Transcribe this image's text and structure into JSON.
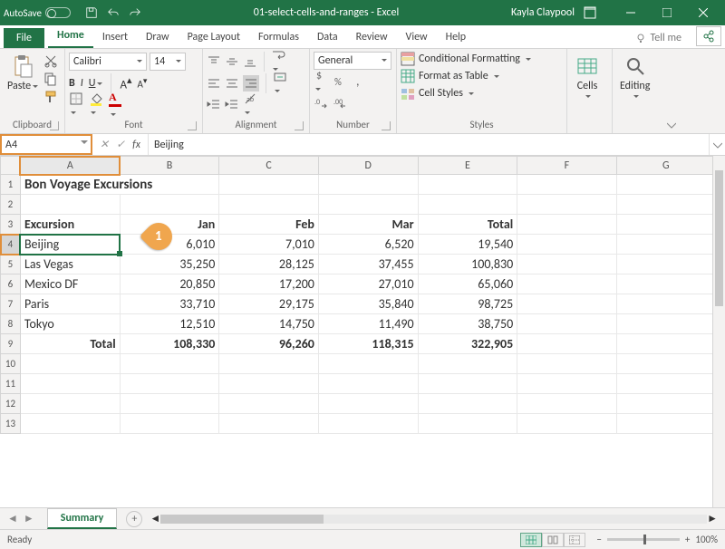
{
  "title": {
    "autosave": "AutoSave",
    "doc": "01-select-cells-and-ranges  -  Excel",
    "user": "Kayla Claypool"
  },
  "tabs": {
    "file": "File",
    "home": "Home",
    "insert": "Insert",
    "draw": "Draw",
    "pagelayout": "Page Layout",
    "formulas": "Formulas",
    "data": "Data",
    "review": "Review",
    "view": "View",
    "help": "Help",
    "tellme": "Tell me"
  },
  "ribbon": {
    "clipboard": {
      "label": "Clipboard",
      "paste": "Paste"
    },
    "font": {
      "label": "Font",
      "name": "Calibri",
      "size": "14"
    },
    "alignment": {
      "label": "Alignment"
    },
    "number": {
      "label": "Number",
      "format": "General"
    },
    "styles": {
      "label": "Styles",
      "cond": "Conditional Formatting",
      "table": "Format as Table",
      "cell": "Cell Styles"
    },
    "cells": {
      "label": "Cells",
      "btn": "Cells"
    },
    "editing": {
      "label": "Editing",
      "btn": "Editing"
    }
  },
  "namebox": "A4",
  "formula": "Beijing",
  "cols": [
    "A",
    "B",
    "C",
    "D",
    "E",
    "F",
    "G"
  ],
  "rows": {
    "1": {
      "A": "Bon Voyage Excursions"
    },
    "3": {
      "A": "Excursion",
      "B": "Jan",
      "C": "Feb",
      "D": "Mar",
      "E": "Total"
    },
    "4": {
      "A": "Beijing",
      "B": "6,010",
      "C": "7,010",
      "D": "6,520",
      "E": "19,540"
    },
    "5": {
      "A": "Las Vegas",
      "B": "35,250",
      "C": "28,125",
      "D": "37,455",
      "E": "100,830"
    },
    "6": {
      "A": "Mexico DF",
      "B": "20,850",
      "C": "17,200",
      "D": "27,010",
      "E": "65,060"
    },
    "7": {
      "A": "Paris",
      "B": "33,710",
      "C": "29,175",
      "D": "35,840",
      "E": "98,725"
    },
    "8": {
      "A": "Tokyo",
      "B": "12,510",
      "C": "14,750",
      "D": "11,490",
      "E": "38,750"
    },
    "9": {
      "A": "Total",
      "B": "108,330",
      "C": "96,260",
      "D": "118,315",
      "E": "322,905"
    }
  },
  "callout": "1",
  "sheet": {
    "active": "Summary"
  },
  "status": {
    "ready": "Ready",
    "zoom": "100%"
  },
  "chart_data": {
    "type": "table",
    "title": "Bon Voyage Excursions",
    "columns": [
      "Excursion",
      "Jan",
      "Feb",
      "Mar",
      "Total"
    ],
    "rows": [
      {
        "Excursion": "Beijing",
        "Jan": 6010,
        "Feb": 7010,
        "Mar": 6520,
        "Total": 19540
      },
      {
        "Excursion": "Las Vegas",
        "Jan": 35250,
        "Feb": 28125,
        "Mar": 37455,
        "Total": 100830
      },
      {
        "Excursion": "Mexico DF",
        "Jan": 20850,
        "Feb": 17200,
        "Mar": 27010,
        "Total": 65060
      },
      {
        "Excursion": "Paris",
        "Jan": 33710,
        "Feb": 29175,
        "Mar": 35840,
        "Total": 98725
      },
      {
        "Excursion": "Tokyo",
        "Jan": 12510,
        "Feb": 14750,
        "Mar": 11490,
        "Total": 38750
      },
      {
        "Excursion": "Total",
        "Jan": 108330,
        "Feb": 96260,
        "Mar": 118315,
        "Total": 322905
      }
    ]
  }
}
